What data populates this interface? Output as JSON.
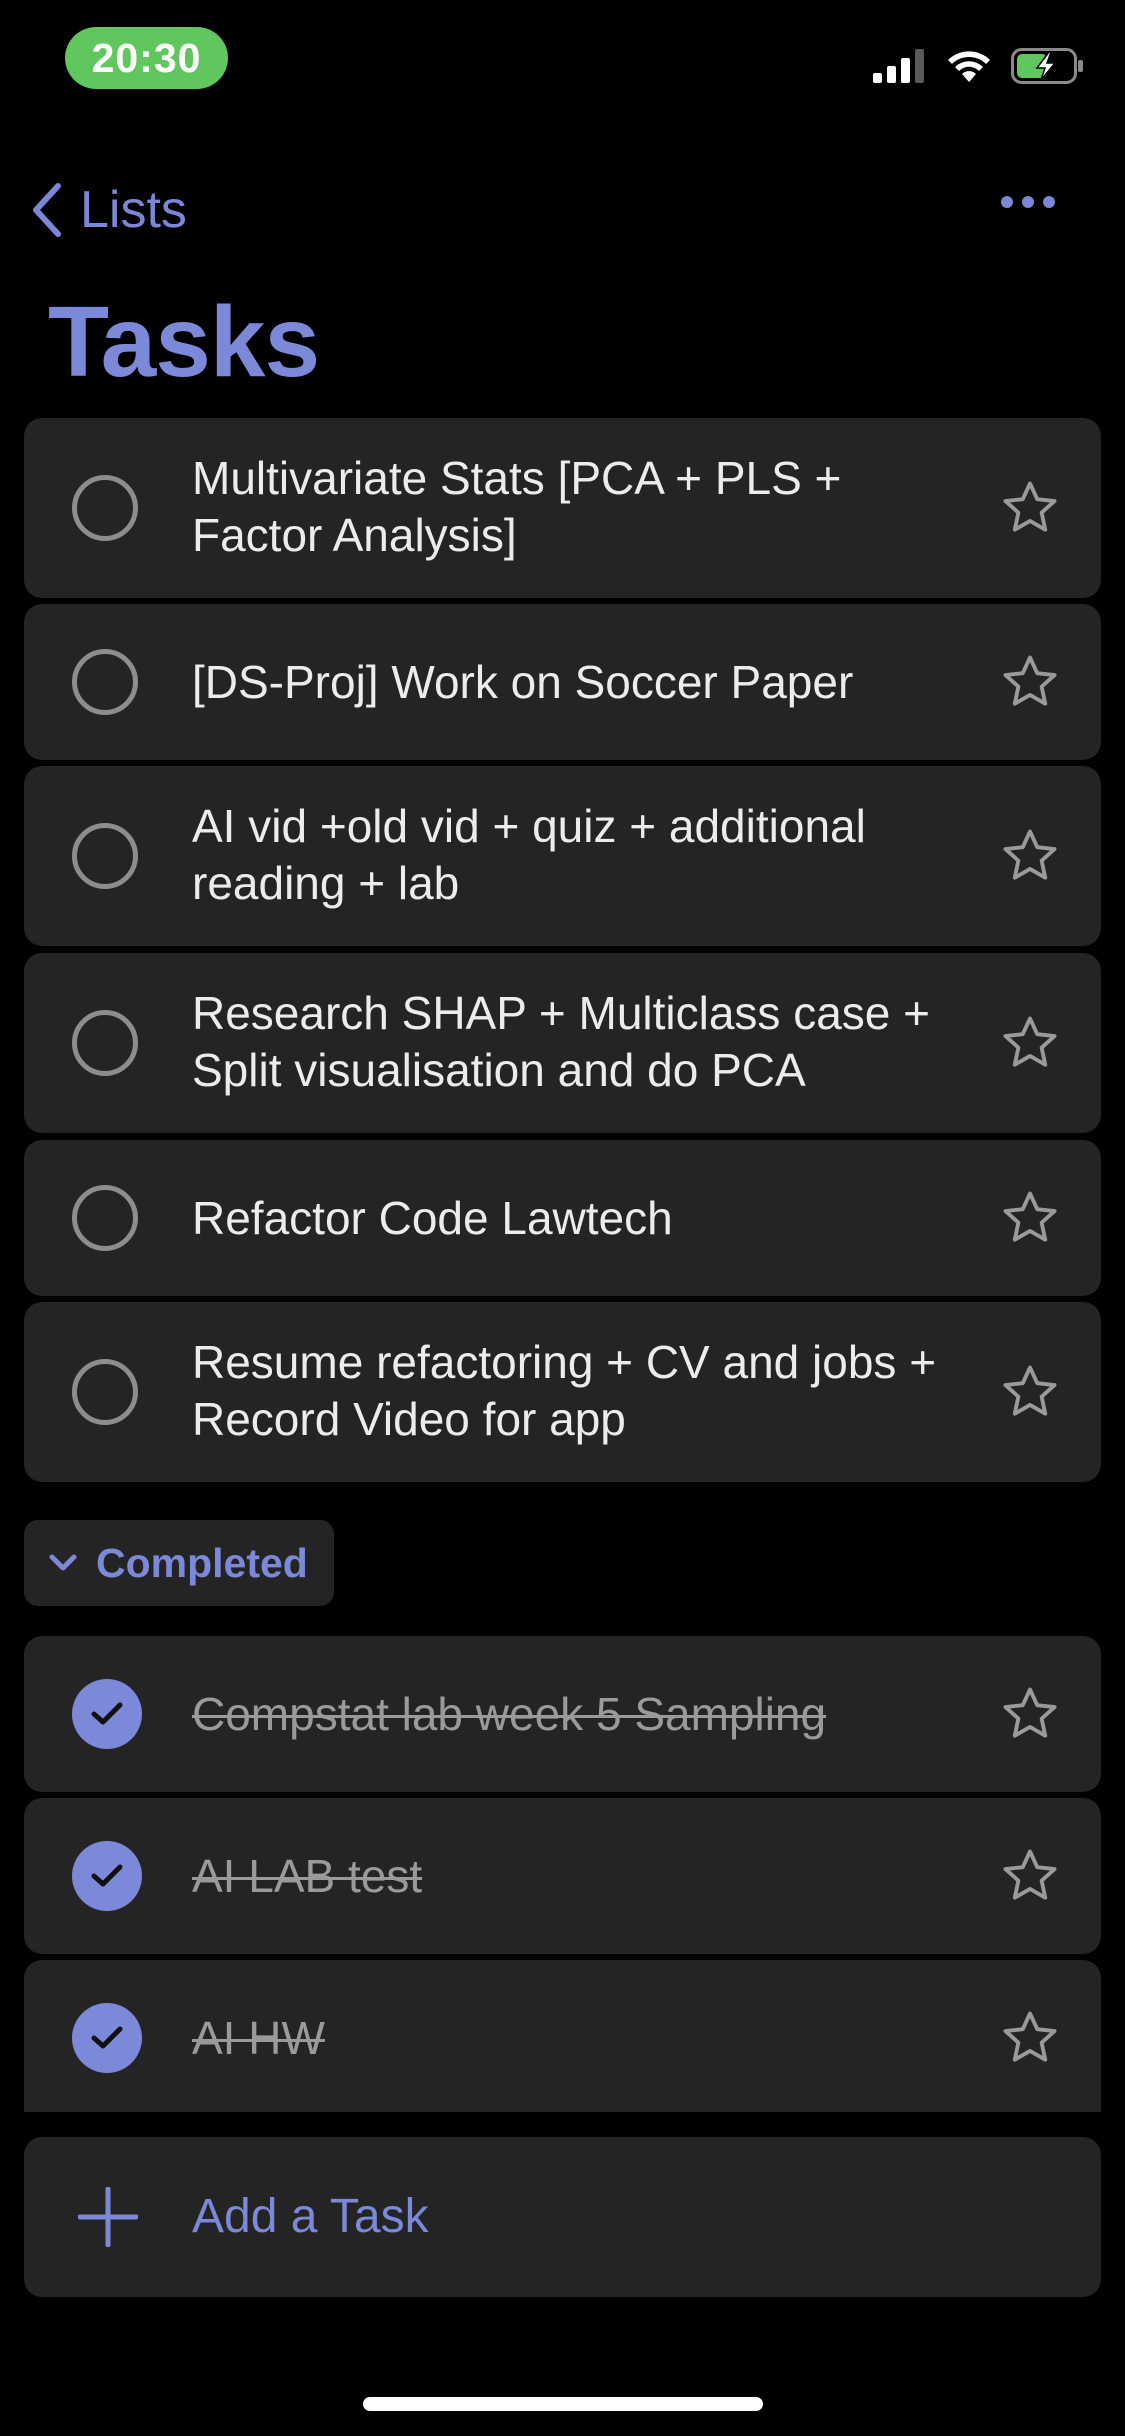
{
  "status_bar": {
    "time": "20:30"
  },
  "nav": {
    "back_label": "Lists"
  },
  "page": {
    "title": "Tasks"
  },
  "tasks": [
    {
      "text": "Multivariate Stats [PCA + PLS + Factor Analysis]",
      "completed": false
    },
    {
      "text": "[DS-Proj] Work on Soccer Paper",
      "completed": false
    },
    {
      "text": "AI vid +old vid + quiz + additional reading + lab",
      "completed": false
    },
    {
      "text": "Research SHAP + Multiclass case + Split visualisation and do PCA",
      "completed": false
    },
    {
      "text": "Refactor Code Lawtech",
      "completed": false
    },
    {
      "text": "Resume refactoring + CV and jobs + Record Video for app",
      "completed": false
    }
  ],
  "completed_section": {
    "label": "Completed",
    "tasks": [
      {
        "text": "Compstat lab week 5 Sampling",
        "completed": true
      },
      {
        "text": "AI LAB test",
        "completed": true
      },
      {
        "text": "AI HW",
        "completed": true
      }
    ]
  },
  "add_task": {
    "label": "Add a Task"
  },
  "colors": {
    "accent": "#7c88d8",
    "background": "#000000",
    "card": "#242424",
    "status_green": "#5fc75d"
  }
}
